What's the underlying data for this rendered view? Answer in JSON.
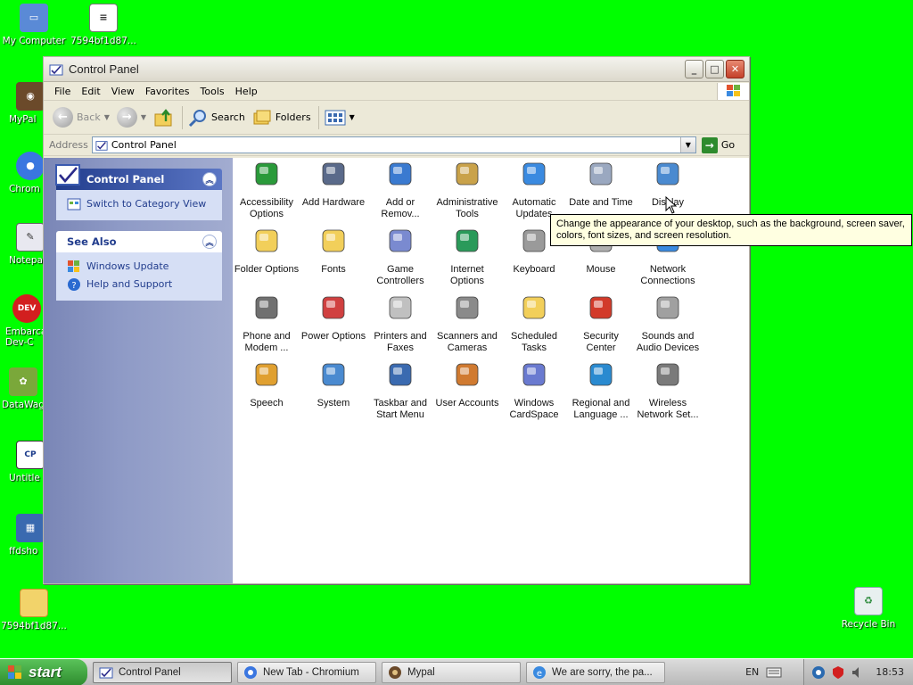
{
  "desktop": {
    "icons": [
      {
        "name": "my-computer",
        "label": "My Computer"
      },
      {
        "name": "file-7594",
        "label": "7594bf1d87..."
      },
      {
        "name": "mypal",
        "label": "MyPal"
      },
      {
        "name": "chromium",
        "label": "Chrom"
      },
      {
        "name": "notepad",
        "label": "Notepa"
      },
      {
        "name": "embarcadero",
        "label": "Embarca"
      },
      {
        "name": "embarcadero-2",
        "label": "Dev-C"
      },
      {
        "name": "datawag",
        "label": "DataWag"
      },
      {
        "name": "untitled",
        "label": "Untitle"
      },
      {
        "name": "ffdshow",
        "label": "ffdsho"
      },
      {
        "name": "folder-7594",
        "label": "7594bf1d87..."
      },
      {
        "name": "recycle-bin",
        "label": "Recycle Bin"
      }
    ]
  },
  "window": {
    "title": "Control Panel",
    "menu": [
      "File",
      "Edit",
      "View",
      "Favorites",
      "Tools",
      "Help"
    ],
    "toolbar": {
      "back": "Back",
      "search": "Search",
      "folders": "Folders"
    },
    "address": {
      "label": "Address",
      "value": "Control Panel",
      "go": "Go"
    }
  },
  "taskpane": {
    "main_title": "Control Panel",
    "main_link": "Switch to Category View",
    "see_also_title": "See Also",
    "see_also_links": [
      "Windows Update",
      "Help and Support"
    ]
  },
  "items": [
    {
      "l1": "Accessibility",
      "l2": "Options",
      "icon": "accessibility-icon"
    },
    {
      "l1": "Add Hardware",
      "l2": "",
      "icon": "add-hardware-icon"
    },
    {
      "l1": "Add or",
      "l2": "Remov...",
      "icon": "add-remove-icon"
    },
    {
      "l1": "Administrative",
      "l2": "Tools",
      "icon": "admin-tools-icon"
    },
    {
      "l1": "Automatic",
      "l2": "Updates",
      "icon": "auto-updates-icon"
    },
    {
      "l1": "Date and Time",
      "l2": "",
      "icon": "date-time-icon"
    },
    {
      "l1": "Display",
      "l2": "",
      "icon": "display-icon"
    },
    {
      "l1": "Folder Options",
      "l2": "",
      "icon": "folder-options-icon"
    },
    {
      "l1": "Fonts",
      "l2": "",
      "icon": "fonts-icon"
    },
    {
      "l1": "Game",
      "l2": "Controllers",
      "icon": "game-controllers-icon"
    },
    {
      "l1": "Internet",
      "l2": "Options",
      "icon": "internet-options-icon"
    },
    {
      "l1": "Keyboard",
      "l2": "",
      "icon": "keyboard-icon"
    },
    {
      "l1": "Mouse",
      "l2": "",
      "icon": "mouse-icon"
    },
    {
      "l1": "Network",
      "l2": "Connections",
      "icon": "network-icon"
    },
    {
      "l1": "Phone and",
      "l2": "Modem ...",
      "icon": "phone-modem-icon"
    },
    {
      "l1": "Power Options",
      "l2": "",
      "icon": "power-options-icon"
    },
    {
      "l1": "Printers and",
      "l2": "Faxes",
      "icon": "printers-icon"
    },
    {
      "l1": "Scanners and",
      "l2": "Cameras",
      "icon": "scanners-icon"
    },
    {
      "l1": "Scheduled",
      "l2": "Tasks",
      "icon": "scheduled-tasks-icon"
    },
    {
      "l1": "Security",
      "l2": "Center",
      "icon": "security-center-icon"
    },
    {
      "l1": "Sounds and",
      "l2": "Audio Devices",
      "icon": "sounds-icon"
    },
    {
      "l1": "Speech",
      "l2": "",
      "icon": "speech-icon"
    },
    {
      "l1": "System",
      "l2": "",
      "icon": "system-icon"
    },
    {
      "l1": "Taskbar and",
      "l2": "Start Menu",
      "icon": "taskbar-icon"
    },
    {
      "l1": "User Accounts",
      "l2": "",
      "icon": "user-accounts-icon"
    },
    {
      "l1": "Windows",
      "l2": "CardSpace",
      "icon": "cardspace-icon"
    },
    {
      "l1": "Regional and",
      "l2": "Language ...",
      "icon": "regional-icon"
    },
    {
      "l1": "Wireless",
      "l2": "Network Set...",
      "icon": "wireless-icon"
    }
  ],
  "tooltip": {
    "line1": "Change the appearance of your desktop, such as the background, screen saver,",
    "line2": "colors, font sizes, and screen resolution."
  },
  "taskbar": {
    "start": "start",
    "tasks": [
      "Control Panel",
      "New Tab - Chromium",
      "Mypal",
      "We are sorry, the pa..."
    ],
    "lang": "EN",
    "time": "18:53"
  }
}
